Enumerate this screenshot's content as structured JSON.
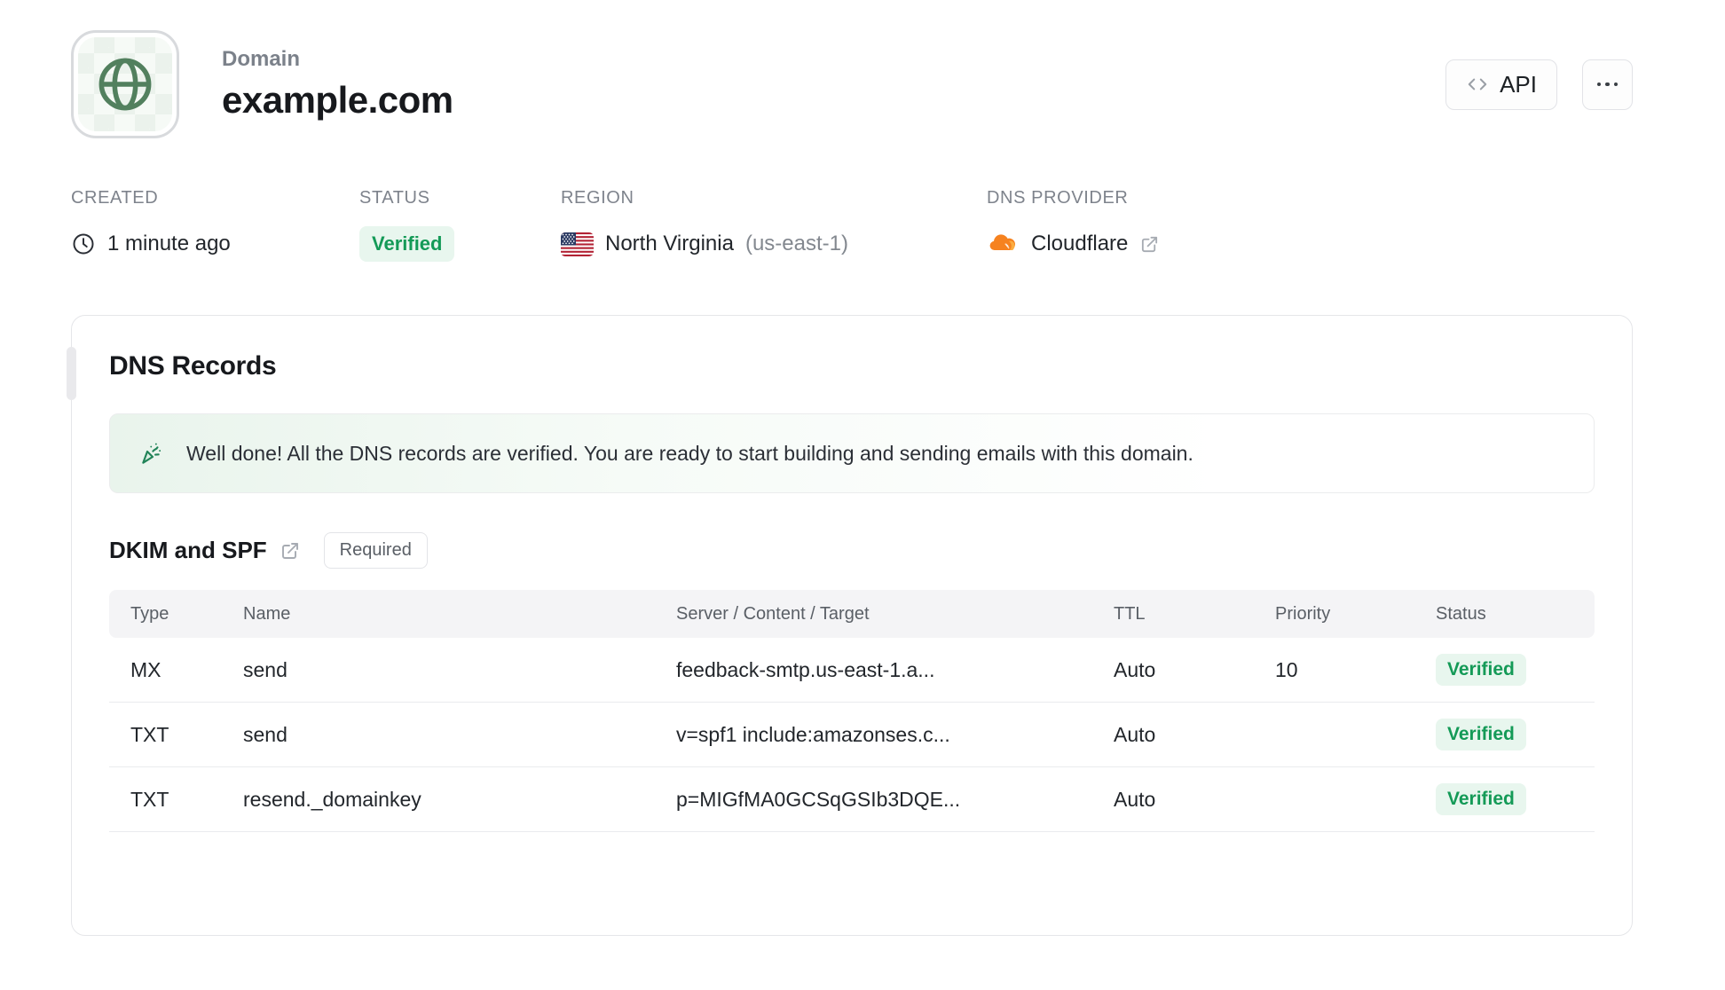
{
  "header": {
    "label": "Domain",
    "title": "example.com",
    "api_button_label": "API",
    "more_button": "more options"
  },
  "meta": {
    "created": {
      "label": "CREATED",
      "value": "1 minute ago"
    },
    "status": {
      "label": "STATUS",
      "value": "Verified"
    },
    "region": {
      "label": "REGION",
      "value": "North Virginia",
      "suffix": "(us-east-1)"
    },
    "dns_provider": {
      "label": "DNS PROVIDER",
      "value": "Cloudflare"
    }
  },
  "dns_card": {
    "title": "DNS Records",
    "banner_text": "Well done! All the DNS records are verified. You are ready to start building and sending emails with this domain.",
    "section_title": "DKIM and SPF",
    "required_badge": "Required",
    "table": {
      "columns": [
        "Type",
        "Name",
        "Server / Content / Target",
        "TTL",
        "Priority",
        "Status"
      ],
      "rows": [
        {
          "type": "MX",
          "name": "send",
          "content": "feedback-smtp.us-east-1.a...",
          "ttl": "Auto",
          "priority": "10",
          "status": "Verified"
        },
        {
          "type": "TXT",
          "name": "send",
          "content": "v=spf1 include:amazonses.c...",
          "ttl": "Auto",
          "priority": "",
          "status": "Verified"
        },
        {
          "type": "TXT",
          "name": "resend._domainkey",
          "content": "p=MIGfMA0GCSqGSIb3DQE...",
          "ttl": "Auto",
          "priority": "",
          "status": "Verified"
        }
      ]
    }
  },
  "colors": {
    "accent_green": "#149a57",
    "verified_badge_bg": "#e8f6ee",
    "globe_green": "#52805e",
    "cloudflare_orange": "#f6821f",
    "cloudflare_orange_light": "#fbad41",
    "banner_gradient_from": "#e9f4ec",
    "table_header_bg": "#f4f4f6"
  }
}
